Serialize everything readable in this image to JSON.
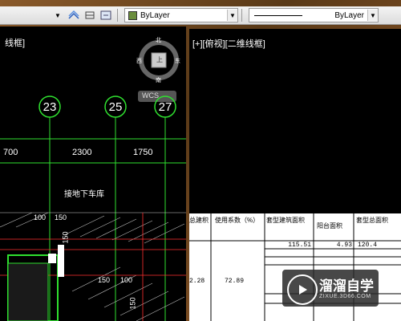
{
  "toolbar": {
    "color_label": "ByLayer",
    "linetype_label": "ByLayer"
  },
  "left_viewport": {
    "title": "线框]",
    "compass": {
      "north": "北",
      "south": "南",
      "west": "西",
      "east": "东",
      "center": "上"
    },
    "wcs": "WCS",
    "grid_labels": [
      "23",
      "25",
      "27"
    ],
    "dims": [
      "700",
      "2300",
      "1750"
    ],
    "annotation": "接地下车库",
    "small_dims": [
      "100",
      "150",
      "150",
      "150",
      "100",
      "150"
    ]
  },
  "right_viewport": {
    "title": "[+][俯视][二维线框]"
  },
  "table": {
    "headers": [
      "总建积",
      "使用系数（%）",
      "套型建筑面积",
      "阳台面积",
      "套型总面积"
    ],
    "row1": [
      "",
      "",
      "115.51",
      "4.93",
      "120.4"
    ],
    "row2": [
      "2.28",
      "72.89"
    ]
  },
  "watermark": {
    "title": "溜溜自学",
    "subtitle": "ZIXUE.3D66.COM"
  }
}
